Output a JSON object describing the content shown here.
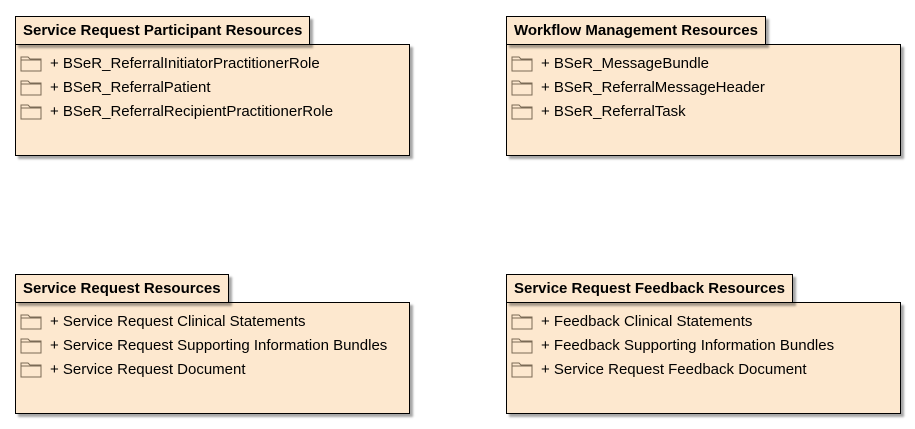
{
  "packages": [
    {
      "id": "participant",
      "title": "Service Request Participant Resources",
      "items": [
        "+ BSeR_ReferralInitiatorPractitionerRole",
        "+ BSeR_ReferralPatient",
        "+ BSeR_ReferralRecipientPractitionerRole"
      ]
    },
    {
      "id": "workflow",
      "title": "Workflow Management Resources",
      "items": [
        "+ BSeR_MessageBundle",
        "+ BSeR_ReferralMessageHeader",
        "+ BSeR_ReferralTask"
      ]
    },
    {
      "id": "service-request",
      "title": "Service Request Resources",
      "items": [
        "+ Service Request Clinical Statements",
        "+ Service Request Supporting Information Bundles",
        "+ Service Request Document"
      ]
    },
    {
      "id": "feedback",
      "title": "Service Request Feedback Resources",
      "items": [
        "+ Feedback Clinical Statements",
        "+ Feedback Supporting Information Bundles",
        "+ Service Request Feedback Document"
      ]
    }
  ],
  "icon": "folder-icon",
  "colors": {
    "package_fill": "#fde8cf",
    "border": "#000000"
  }
}
